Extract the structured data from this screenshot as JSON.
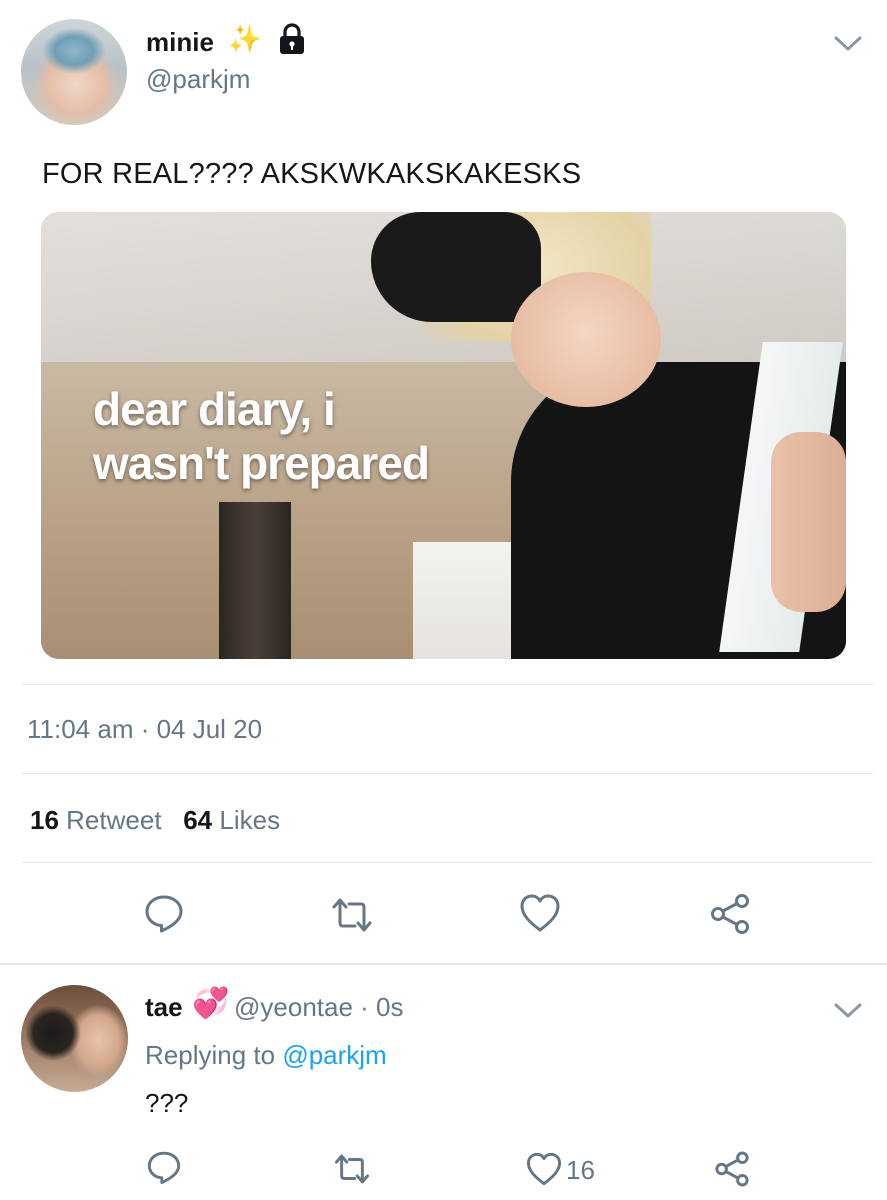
{
  "tweet": {
    "display_name": "minie",
    "handle": "@parkjm",
    "text": "FOR REAL???? AKSKWKAKSKAKESKS",
    "media_caption_line1": "dear diary, i",
    "media_caption_line2": "wasn't prepared",
    "timestamp": "11:04 am · 04 Jul 20",
    "retweet_count": "16",
    "retweet_label": "Retweet",
    "like_count": "64",
    "like_label": "Likes",
    "icons": {
      "name_emoji": "sparkles-icon",
      "protected": "lock-icon",
      "menu": "chevron-down-icon",
      "actions": [
        "reply-icon",
        "retweet-icon",
        "like-icon",
        "share-icon"
      ]
    }
  },
  "reply": {
    "display_name": "tae",
    "handle_time": "@yeontae · 0s",
    "replying_prefix": "Replying to",
    "replying_to": "@parkjm",
    "text": "???",
    "like_count": "16",
    "icons": {
      "name_emoji": "revolving-hearts-icon",
      "menu": "chevron-down-icon",
      "actions": [
        "reply-icon",
        "retweet-icon",
        "like-icon",
        "share-icon"
      ]
    }
  },
  "colors": {
    "primary_text": "#14171a",
    "secondary_text": "#657786",
    "link": "#1da1f2",
    "divider": "#e1e8ed",
    "icon": "#657786"
  }
}
